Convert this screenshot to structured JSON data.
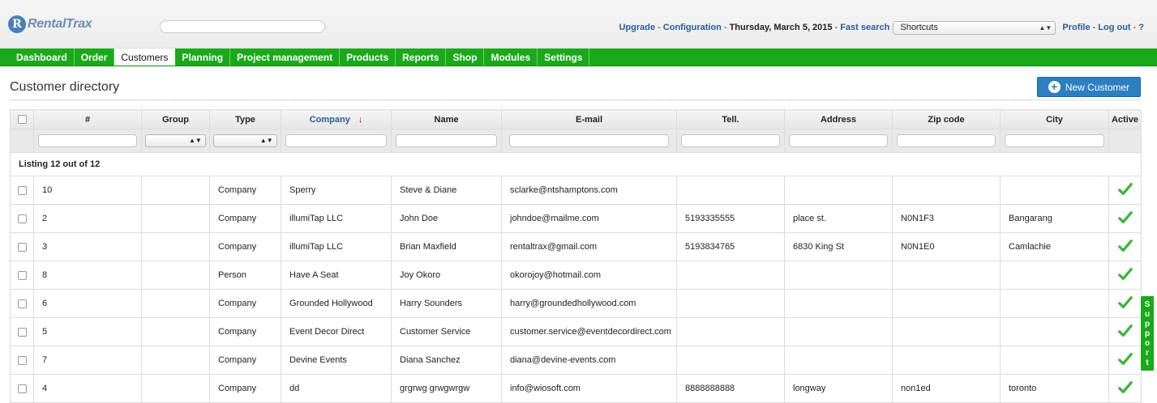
{
  "header": {
    "logo_text": "RentalTrax",
    "logo_mark": "R",
    "links": {
      "upgrade": "Upgrade",
      "configuration": "Configuration",
      "date": "Thursday, March 5, 2015",
      "fast_search": "Fast search",
      "shortcuts_value": "Shortcuts",
      "profile": "Profile",
      "logout": "Log out",
      "help": "?"
    }
  },
  "nav": {
    "items": [
      "Dashboard",
      "Order",
      "Customers",
      "Planning",
      "Project management",
      "Products",
      "Reports",
      "Shop",
      "Modules",
      "Settings"
    ],
    "active": "Customers"
  },
  "page": {
    "title": "Customer directory",
    "new_button": "New Customer"
  },
  "table": {
    "columns": [
      "#",
      "Group",
      "Type",
      "Company",
      "Name",
      "E-mail",
      "Tell.",
      "Address",
      "Zip code",
      "City",
      "Active"
    ],
    "sorted_column": "Company",
    "listing": "Listing 12 out of 12",
    "rows": [
      [
        "10",
        "",
        "Company",
        "Sperry",
        "Steve & Diane",
        "sclarke@ntshamptons.com",
        "",
        "",
        "",
        ""
      ],
      [
        "2",
        "",
        "Company",
        "illumiTap LLC",
        "John Doe",
        "johndoe@mailme.com",
        "5193335555",
        "place st.",
        "N0N1F3",
        "Bangarang"
      ],
      [
        "3",
        "",
        "Company",
        "illumiTap LLC",
        "Brian Maxfield",
        "rentaltrax@gmail.com",
        "5193834765",
        "6830 King St",
        "N0N1E0",
        "Camlachie"
      ],
      [
        "8",
        "",
        "Person",
        "Have A Seat",
        "Joy Okoro",
        "okorojoy@hotmail.com",
        "",
        "",
        "",
        ""
      ],
      [
        "6",
        "",
        "Company",
        "Grounded Hollywood",
        "Harry Sounders",
        "harry@groundedhollywood.com",
        "",
        "",
        "",
        ""
      ],
      [
        "5",
        "",
        "Company",
        "Event Decor Direct",
        "Customer Service",
        "customer.service@eventdecordirect.com",
        "",
        "",
        "",
        ""
      ],
      [
        "7",
        "",
        "Company",
        "Devine Events",
        "Diana Sanchez",
        "diana@devine-events.com",
        "",
        "",
        "",
        ""
      ],
      [
        "4",
        "",
        "Company",
        "dd",
        "grgrwg grwgwrgw",
        "info@wiosoft.com",
        "8888888888",
        "longway",
        "non1ed",
        "toronto"
      ]
    ]
  },
  "support": {
    "label": "Support"
  },
  "colors": {
    "nav_green": "#1aaa19",
    "link_blue": "#2a5d9a",
    "button_blue": "#2c7fc0",
    "check_green": "#3ab53a"
  }
}
